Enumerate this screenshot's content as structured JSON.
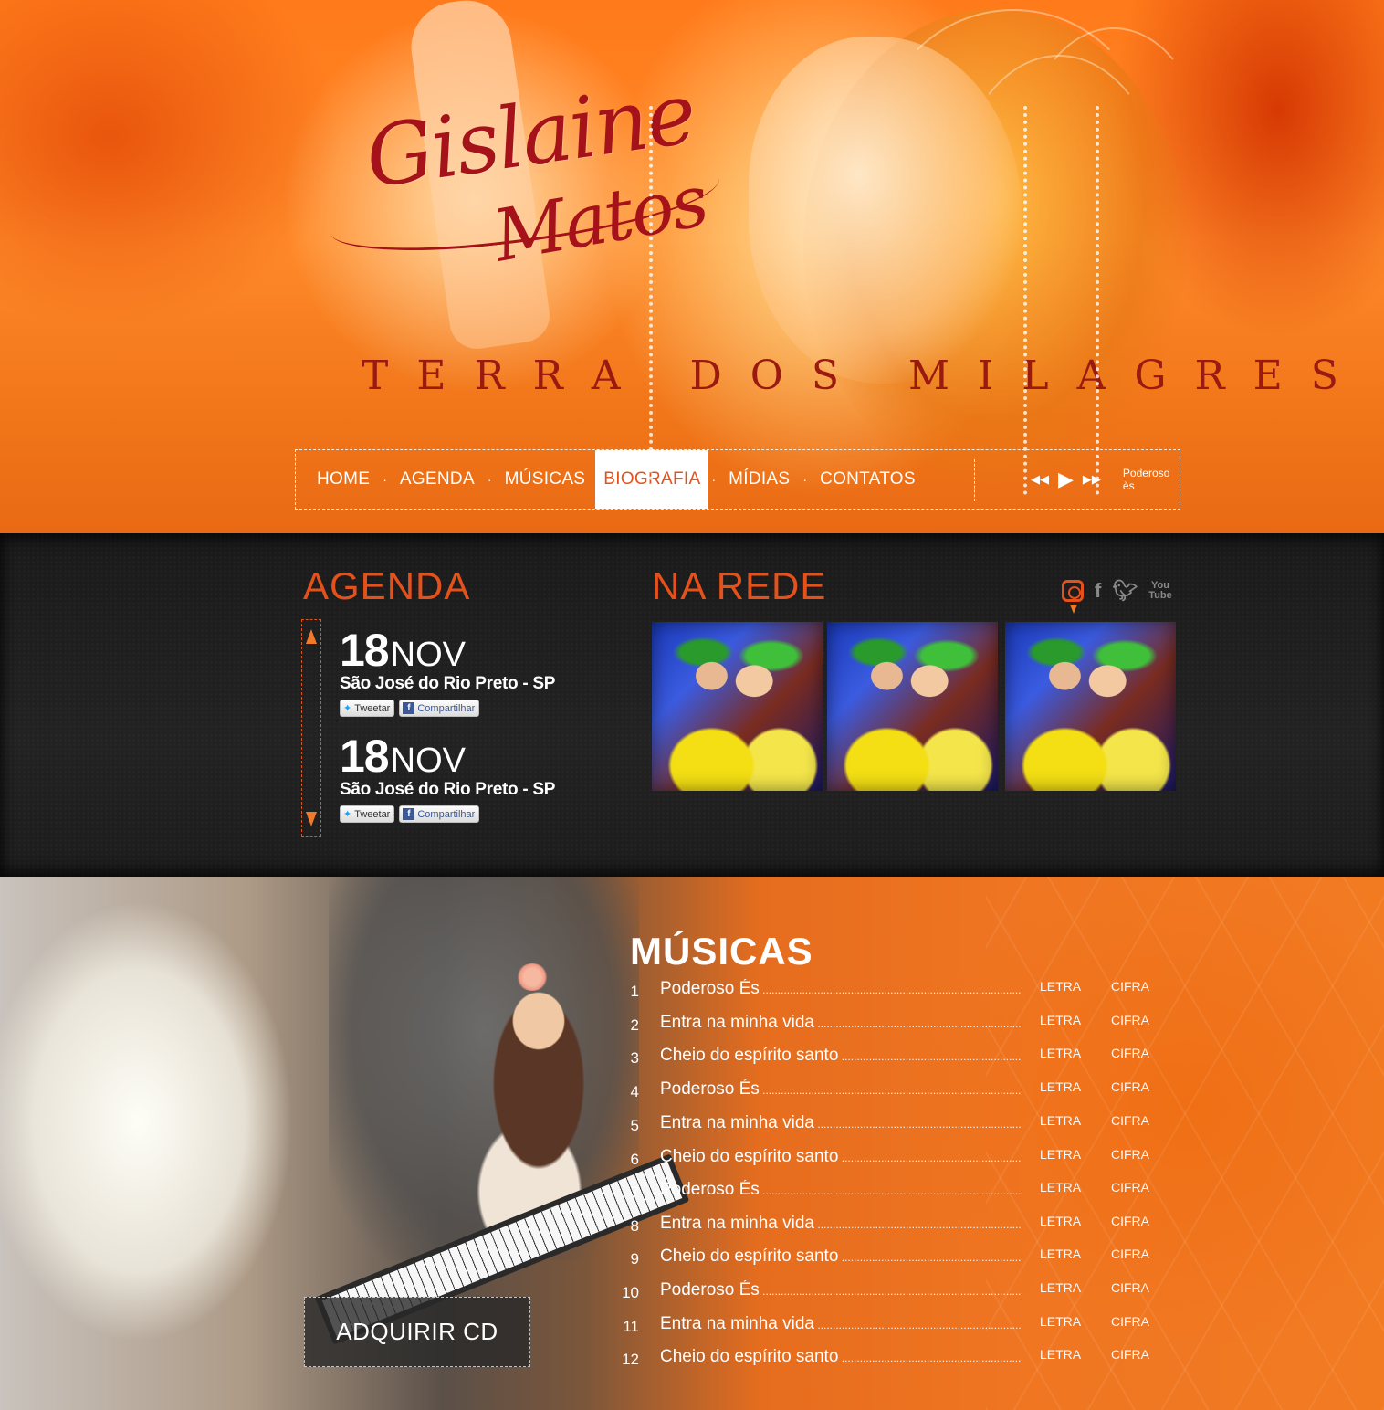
{
  "hero": {
    "logo_line1": "Gislaine",
    "logo_line2": "Matos",
    "tagline": "TERRA DOS MILAGRES"
  },
  "nav": {
    "items": [
      {
        "label": "HOME"
      },
      {
        "label": "AGENDA"
      },
      {
        "label": "MÚSICAS"
      },
      {
        "label": "BIOGRAFIA",
        "active": true
      },
      {
        "label": "MÍDIAS"
      },
      {
        "label": "CONTATOS"
      }
    ],
    "separator": "·",
    "player": {
      "prev_icon": "rewind-icon",
      "play_icon": "play-icon",
      "next_icon": "fast-forward-icon",
      "now_playing": "Poderoso ès"
    }
  },
  "agenda": {
    "title": "AGENDA",
    "events": [
      {
        "day": "18",
        "month": "NOV",
        "place": "São José do Rio Preto - SP",
        "tweet_label": "Tweetar",
        "share_label": "Compartilhar"
      },
      {
        "day": "18",
        "month": "NOV",
        "place": "São José do Rio Preto - SP",
        "tweet_label": "Tweetar",
        "share_label": "Compartilhar"
      }
    ]
  },
  "rede": {
    "title": "NA REDE",
    "social_icons": [
      "instagram-icon",
      "facebook-icon",
      "twitter-icon",
      "youtube-icon"
    ],
    "youtube_top": "You",
    "youtube_bottom": "Tube",
    "photos": 3
  },
  "musicas": {
    "title": "MÚSICAS",
    "buy_label": "ADQUIRIR CD",
    "letra_label": "LETRA",
    "cifra_label": "CIFRA",
    "tracks": [
      {
        "num": "1",
        "title": "Poderoso És"
      },
      {
        "num": "2",
        "title": "Entra na minha vida"
      },
      {
        "num": "3",
        "title": "Cheio do espírito santo"
      },
      {
        "num": "4",
        "title": "Poderoso És"
      },
      {
        "num": "5",
        "title": "Entra na minha vida"
      },
      {
        "num": "6",
        "title": "Cheio do espírito santo"
      },
      {
        "num": "7",
        "title": "Poderoso És"
      },
      {
        "num": "8",
        "title": "Entra na minha vida"
      },
      {
        "num": "9",
        "title": "Cheio do espírito santo"
      },
      {
        "num": "10",
        "title": "Poderoso És"
      },
      {
        "num": "11",
        "title": "Entra na minha vida"
      },
      {
        "num": "12",
        "title": "Cheio do espírito santo"
      }
    ]
  },
  "colors": {
    "accent": "#e5511a",
    "logo": "#a5121a",
    "dark_bg": "#1b1b1b"
  }
}
